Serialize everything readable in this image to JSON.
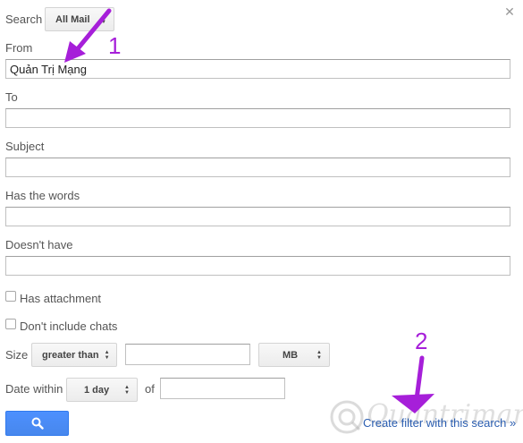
{
  "search": {
    "label": "Search",
    "scope_value": "All Mail"
  },
  "fields": {
    "from": {
      "label": "From",
      "value": "Quản Trị Mạng"
    },
    "to": {
      "label": "To",
      "value": ""
    },
    "subject": {
      "label": "Subject",
      "value": ""
    },
    "has_words": {
      "label": "Has the words",
      "value": ""
    },
    "doesnt_have": {
      "label": "Doesn't have",
      "value": ""
    }
  },
  "options": {
    "has_attachment": {
      "label": "Has attachment",
      "checked": false
    },
    "dont_include_chats": {
      "label": "Don't include chats",
      "checked": false
    }
  },
  "size": {
    "label": "Size",
    "comparator": "greater than",
    "value": "",
    "unit": "MB"
  },
  "date_within": {
    "label": "Date within",
    "range": "1 day",
    "of_label": "of",
    "value": ""
  },
  "actions": {
    "create_filter_label": "Create filter with this search »"
  },
  "annotations": {
    "step_1": "1",
    "step_2": "2"
  },
  "watermark": {
    "text": "Quantrimang"
  },
  "colors": {
    "accent_blue": "#4d90fe",
    "link_blue": "#2a5db0",
    "annotation_purple": "#a61fd9"
  },
  "icons": {
    "search_button": "search-icon",
    "close": "close-icon"
  }
}
